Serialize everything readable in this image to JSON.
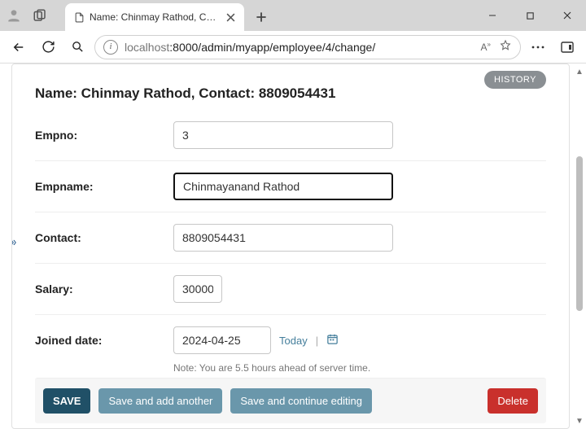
{
  "browser": {
    "tab_title": "Name: Chinmay Rathod, Contact…",
    "url_host": "localhost",
    "url_rest": ":8000/admin/myapp/employee/4/change/"
  },
  "page": {
    "history_label": "HISTORY",
    "object_title": "Name: Chinmay Rathod, Contact: 8809054431",
    "fields": {
      "empno": {
        "label": "Empno:",
        "value": "3"
      },
      "empname": {
        "label": "Empname:",
        "value": "Chinmayanand Rathod"
      },
      "contact": {
        "label": "Contact:",
        "value": "8809054431"
      },
      "salary": {
        "label": "Salary:",
        "value": "30000"
      },
      "joined": {
        "label": "Joined date:",
        "value": "2024-04-25",
        "today_label": "Today"
      }
    },
    "tz_note": "Note: You are 5.5 hours ahead of server time.",
    "buttons": {
      "save": "SAVE",
      "save_add": "Save and add another",
      "save_cont": "Save and continue editing",
      "delete": "Delete"
    }
  }
}
